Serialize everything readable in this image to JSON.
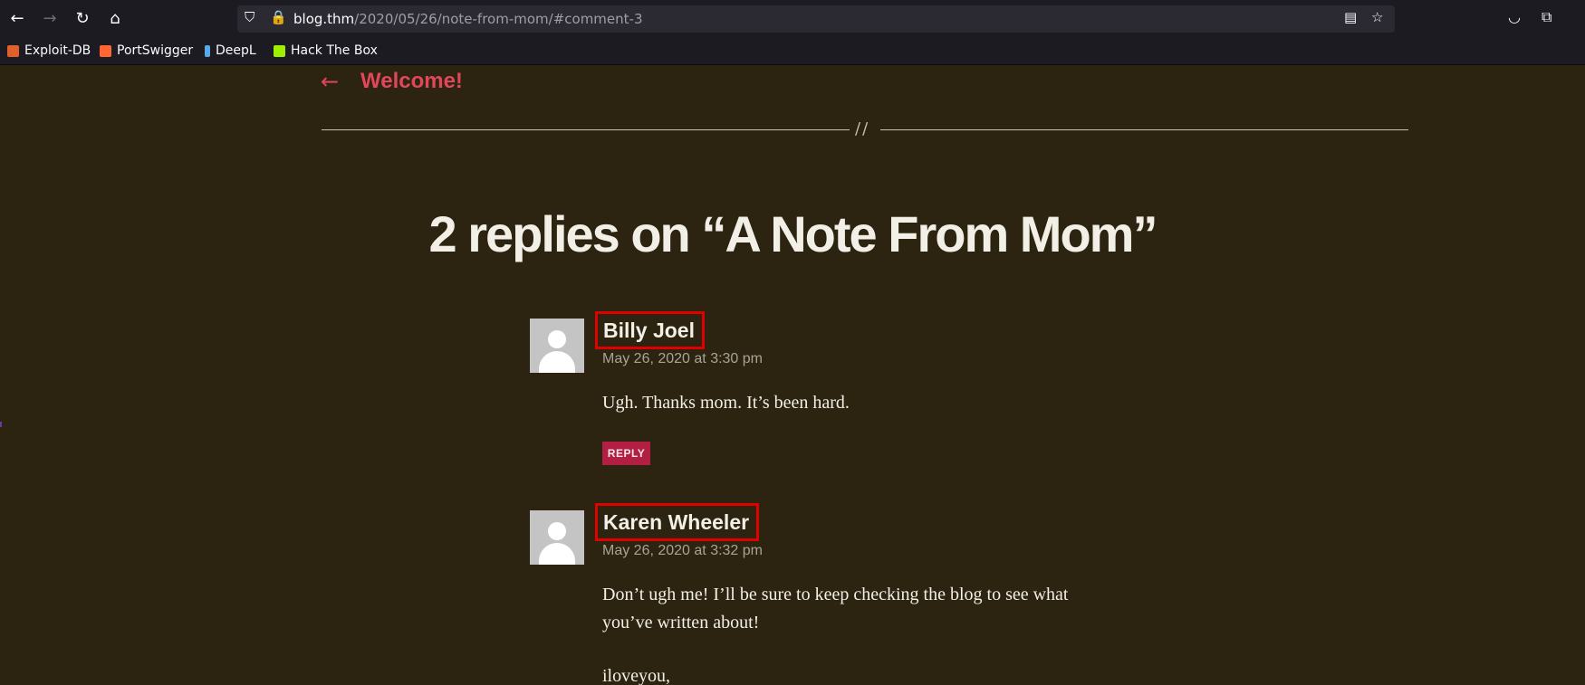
{
  "browser": {
    "url_host": "blog.thm",
    "url_path": "/2020/05/26/note-from-mom/#comment-3",
    "icons": {
      "back": "arrow-left-icon",
      "forward": "arrow-right-icon",
      "reload": "reload-icon",
      "home": "home-icon",
      "shield": "shield-icon",
      "lock": "lock-icon",
      "reader": "reader-view-icon",
      "bookmark": "star-icon",
      "pocket": "pocket-icon",
      "extensions": "puzzle-icon"
    }
  },
  "bookmarks": [
    {
      "label": "Exploit-DB",
      "color": "#e0602c"
    },
    {
      "label": "PortSwigger",
      "color": "#ff6633"
    },
    {
      "label": "DeepL",
      "color": "#5aa8e8"
    },
    {
      "label": "Hack The Box",
      "color": "#9fef00"
    }
  ],
  "page": {
    "back_link": "Welcome!",
    "divider": "//",
    "replies_title": "2 replies on “A Note From Mom”",
    "comments": [
      {
        "author": "Billy Joel",
        "date": "May 26, 2020 at 3:30 pm",
        "paragraphs": [
          "Ugh. Thanks mom. It’s been hard."
        ],
        "reply_label": "REPLY"
      },
      {
        "author": "Karen Wheeler",
        "date": "May 26, 2020 at 3:32 pm",
        "paragraphs": [
          "Don’t ugh me! I’ll be sure to keep checking the blog to see what",
          "you’ve written about!",
          "iloveyou,"
        ]
      }
    ]
  },
  "colors": {
    "page_bg": "#2c2410",
    "accent": "#e0475b",
    "reply_bg": "#b21f43",
    "highlight": "#e00000"
  }
}
